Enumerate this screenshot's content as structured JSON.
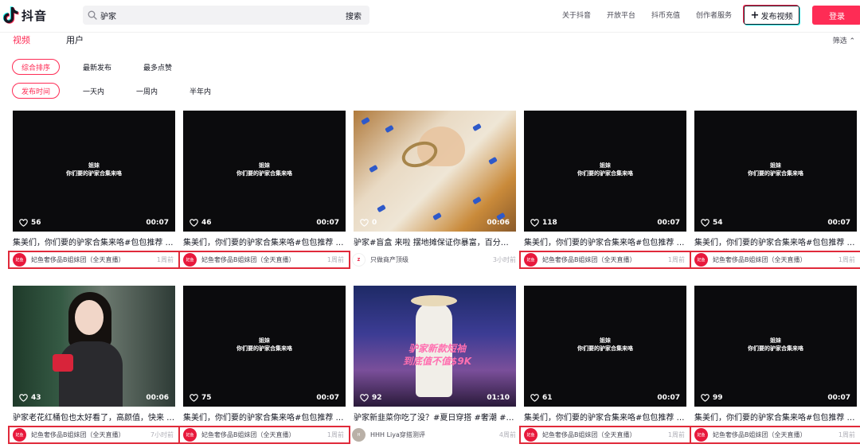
{
  "header": {
    "logo_text": "抖音",
    "search": {
      "value": "驴家",
      "button_label": "搜索"
    },
    "links": [
      "关于抖音",
      "开放平台",
      "抖币充值",
      "创作者服务"
    ],
    "publish_label": "发布视频",
    "login_label": "登录"
  },
  "tabs": [
    {
      "label": "视频",
      "active": true
    },
    {
      "label": "用户",
      "active": false
    }
  ],
  "filter_toggle_label": "筛选",
  "sort_filters": [
    {
      "label": "综合排序",
      "active": true
    },
    {
      "label": "最新发布",
      "active": false
    },
    {
      "label": "最多点赞",
      "active": false
    }
  ],
  "time_filters": [
    {
      "label": "发布时间",
      "active": true
    },
    {
      "label": "一天内",
      "active": false
    },
    {
      "label": "一周内",
      "active": false
    },
    {
      "label": "半年内",
      "active": false
    }
  ],
  "colors": {
    "accent": "#fe2c55",
    "highlight_box": "#e02a3a"
  },
  "videos": [
    {
      "thumb": "black",
      "overlay_line1": "姐妹",
      "overlay_line2": "你们要的驴家合集来咯",
      "likes": "56",
      "duration": "00:07",
      "title": "集美们，你们要的驴家合集来咯#包包推荐 …",
      "author": "妃鱼奢侈品B姐妹团（全天直播）",
      "avatar_text": "妃鱼",
      "time": "1周前",
      "boxed": true
    },
    {
      "thumb": "black",
      "overlay_line1": "姐妹",
      "overlay_line2": "你们要的驴家合集来咯",
      "likes": "46",
      "duration": "00:07",
      "title": "集美们，你们要的驴家合集来咯#包包推荐 …",
      "author": "妃鱼奢侈品B姐妹团（全天直播）",
      "avatar_text": "妃鱼",
      "time": "1周前",
      "boxed": true
    },
    {
      "thumb": "bag",
      "likes": "0",
      "duration": "00:06",
      "title": "驴家#盲盒 来啦 摆地摊保证你暴富，百分百 …",
      "author": "只做商产顶级",
      "avatar_text": "Z",
      "time": "3小时前",
      "boxed": false
    },
    {
      "thumb": "black",
      "overlay_line1": "姐妹",
      "overlay_line2": "你们要的驴家合集来咯",
      "likes": "118",
      "duration": "00:07",
      "title": "集美们，你们要的驴家合集来咯#包包推荐 …",
      "author": "妃鱼奢侈品B姐妹团（全天直播）",
      "avatar_text": "妃鱼",
      "time": "1周前",
      "boxed": true
    },
    {
      "thumb": "black",
      "overlay_line1": "姐妹",
      "overlay_line2": "你们要的驴家合集来咯",
      "likes": "54",
      "duration": "00:07",
      "title": "集美们，你们要的驴家合集来咯#包包推荐 …",
      "author": "妃鱼奢侈品B姐妹团（全天直播）",
      "avatar_text": "妃鱼",
      "time": "1周前",
      "boxed": true
    },
    {
      "thumb": "woman",
      "likes": "43",
      "duration": "00:06",
      "title": "驴家老花红桶包也太好看了，高颜值，快来 …",
      "author": "妃鱼奢侈品B姐妹团（全天直播）",
      "avatar_text": "妃鱼",
      "time": "7小时前",
      "boxed": true
    },
    {
      "thumb": "black",
      "overlay_line1": "姐妹",
      "overlay_line2": "你们要的驴家合集来咯",
      "likes": "75",
      "duration": "00:07",
      "title": "集美们，你们要的驴家合集来咯#包包推荐 …",
      "author": "妃鱼奢侈品B姐妹团（全天直播）",
      "avatar_text": "妃鱼",
      "time": "1周前",
      "boxed": true
    },
    {
      "thumb": "party",
      "caption1": "驴家新款短袖",
      "caption2": "到底值不值$9K",
      "likes": "92",
      "duration": "01:10",
      "title": "驴家新韭菜你吃了没？#夏日穿搭 #奢潮 #…",
      "author": "HHH Liya穿搭测评",
      "avatar_text": "H",
      "time": "4周前",
      "boxed": false
    },
    {
      "thumb": "black",
      "overlay_line1": "姐妹",
      "overlay_line2": "你们要的驴家合集来咯",
      "likes": "61",
      "duration": "00:07",
      "title": "集美们，你们要的驴家合集来咯#包包推荐 …",
      "author": "妃鱼奢侈品B姐妹团（全天直播）",
      "avatar_text": "妃鱼",
      "time": "1周前",
      "boxed": true
    },
    {
      "thumb": "black",
      "overlay_line1": "姐妹",
      "overlay_line2": "你们要的驴家合集来咯",
      "likes": "99",
      "duration": "00:07",
      "title": "集美们，你们要的驴家合集来咯#包包推荐 …",
      "author": "妃鱼奢侈品B姐妹团（全天直播）",
      "avatar_text": "妃鱼",
      "time": "1周前",
      "boxed": true
    }
  ]
}
